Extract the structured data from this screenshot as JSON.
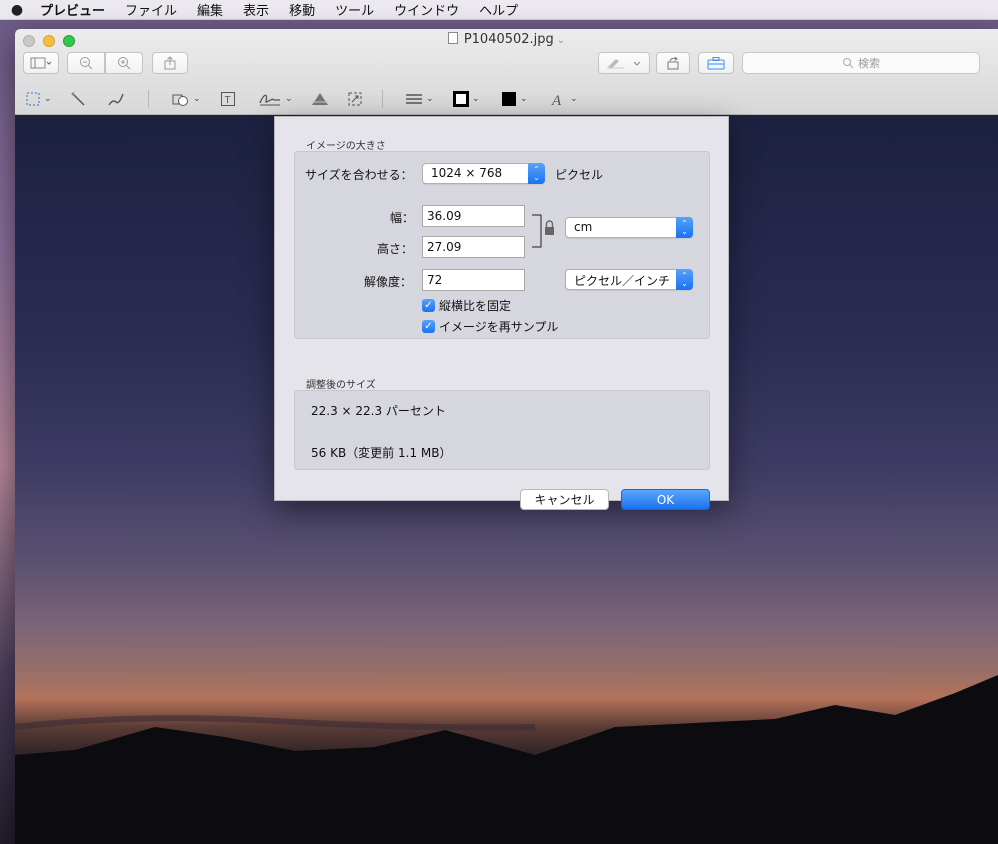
{
  "menubar": {
    "apple": "",
    "items": [
      "プレビュー",
      "ファイル",
      "編集",
      "表示",
      "移動",
      "ツール",
      "ウインドウ",
      "ヘルプ"
    ]
  },
  "window": {
    "title": "P1040502.jpg",
    "search_placeholder": "検索"
  },
  "dialog": {
    "image_size_section": "イメージの大きさ",
    "fit_label": "サイズを合わせる：",
    "fit_value": "1024 × 768",
    "fit_unit": "ピクセル",
    "width_label": "幅：",
    "width_value": "36.09",
    "height_label": "高さ：",
    "height_value": "27.09",
    "size_unit": "cm",
    "resolution_label": "解像度：",
    "resolution_value": "72",
    "resolution_unit": "ピクセル／インチ",
    "scale_proportionally": "縦横比を固定",
    "resample": "イメージを再サンプル",
    "result_section": "調整後のサイズ",
    "result_percent": "22.3 × 22.3 パーセント",
    "result_filesize": "56 KB（変更前 1.1 MB）",
    "cancel": "キャンセル",
    "ok": "OK"
  },
  "colors": {
    "accent": "#1a74f0"
  }
}
